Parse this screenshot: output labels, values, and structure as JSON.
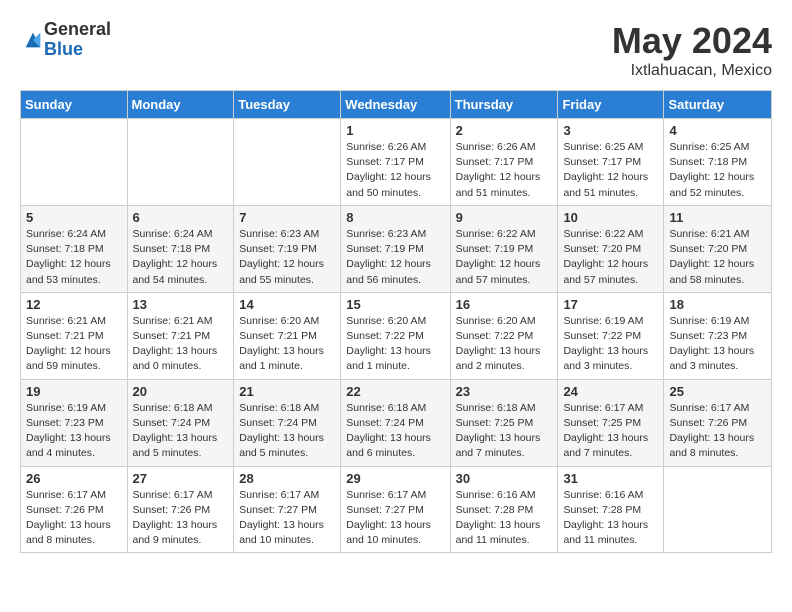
{
  "header": {
    "logo_general": "General",
    "logo_blue": "Blue",
    "title": "May 2024",
    "location": "Ixtlahuacan, Mexico"
  },
  "days_of_week": [
    "Sunday",
    "Monday",
    "Tuesday",
    "Wednesday",
    "Thursday",
    "Friday",
    "Saturday"
  ],
  "weeks": [
    [
      {
        "day": "",
        "info": ""
      },
      {
        "day": "",
        "info": ""
      },
      {
        "day": "",
        "info": ""
      },
      {
        "day": "1",
        "info": "Sunrise: 6:26 AM\nSunset: 7:17 PM\nDaylight: 12 hours\nand 50 minutes."
      },
      {
        "day": "2",
        "info": "Sunrise: 6:26 AM\nSunset: 7:17 PM\nDaylight: 12 hours\nand 51 minutes."
      },
      {
        "day": "3",
        "info": "Sunrise: 6:25 AM\nSunset: 7:17 PM\nDaylight: 12 hours\nand 51 minutes."
      },
      {
        "day": "4",
        "info": "Sunrise: 6:25 AM\nSunset: 7:18 PM\nDaylight: 12 hours\nand 52 minutes."
      }
    ],
    [
      {
        "day": "5",
        "info": "Sunrise: 6:24 AM\nSunset: 7:18 PM\nDaylight: 12 hours\nand 53 minutes."
      },
      {
        "day": "6",
        "info": "Sunrise: 6:24 AM\nSunset: 7:18 PM\nDaylight: 12 hours\nand 54 minutes."
      },
      {
        "day": "7",
        "info": "Sunrise: 6:23 AM\nSunset: 7:19 PM\nDaylight: 12 hours\nand 55 minutes."
      },
      {
        "day": "8",
        "info": "Sunrise: 6:23 AM\nSunset: 7:19 PM\nDaylight: 12 hours\nand 56 minutes."
      },
      {
        "day": "9",
        "info": "Sunrise: 6:22 AM\nSunset: 7:19 PM\nDaylight: 12 hours\nand 57 minutes."
      },
      {
        "day": "10",
        "info": "Sunrise: 6:22 AM\nSunset: 7:20 PM\nDaylight: 12 hours\nand 57 minutes."
      },
      {
        "day": "11",
        "info": "Sunrise: 6:21 AM\nSunset: 7:20 PM\nDaylight: 12 hours\nand 58 minutes."
      }
    ],
    [
      {
        "day": "12",
        "info": "Sunrise: 6:21 AM\nSunset: 7:21 PM\nDaylight: 12 hours\nand 59 minutes."
      },
      {
        "day": "13",
        "info": "Sunrise: 6:21 AM\nSunset: 7:21 PM\nDaylight: 13 hours\nand 0 minutes."
      },
      {
        "day": "14",
        "info": "Sunrise: 6:20 AM\nSunset: 7:21 PM\nDaylight: 13 hours\nand 1 minute."
      },
      {
        "day": "15",
        "info": "Sunrise: 6:20 AM\nSunset: 7:22 PM\nDaylight: 13 hours\nand 1 minute."
      },
      {
        "day": "16",
        "info": "Sunrise: 6:20 AM\nSunset: 7:22 PM\nDaylight: 13 hours\nand 2 minutes."
      },
      {
        "day": "17",
        "info": "Sunrise: 6:19 AM\nSunset: 7:22 PM\nDaylight: 13 hours\nand 3 minutes."
      },
      {
        "day": "18",
        "info": "Sunrise: 6:19 AM\nSunset: 7:23 PM\nDaylight: 13 hours\nand 3 minutes."
      }
    ],
    [
      {
        "day": "19",
        "info": "Sunrise: 6:19 AM\nSunset: 7:23 PM\nDaylight: 13 hours\nand 4 minutes."
      },
      {
        "day": "20",
        "info": "Sunrise: 6:18 AM\nSunset: 7:24 PM\nDaylight: 13 hours\nand 5 minutes."
      },
      {
        "day": "21",
        "info": "Sunrise: 6:18 AM\nSunset: 7:24 PM\nDaylight: 13 hours\nand 5 minutes."
      },
      {
        "day": "22",
        "info": "Sunrise: 6:18 AM\nSunset: 7:24 PM\nDaylight: 13 hours\nand 6 minutes."
      },
      {
        "day": "23",
        "info": "Sunrise: 6:18 AM\nSunset: 7:25 PM\nDaylight: 13 hours\nand 7 minutes."
      },
      {
        "day": "24",
        "info": "Sunrise: 6:17 AM\nSunset: 7:25 PM\nDaylight: 13 hours\nand 7 minutes."
      },
      {
        "day": "25",
        "info": "Sunrise: 6:17 AM\nSunset: 7:26 PM\nDaylight: 13 hours\nand 8 minutes."
      }
    ],
    [
      {
        "day": "26",
        "info": "Sunrise: 6:17 AM\nSunset: 7:26 PM\nDaylight: 13 hours\nand 8 minutes."
      },
      {
        "day": "27",
        "info": "Sunrise: 6:17 AM\nSunset: 7:26 PM\nDaylight: 13 hours\nand 9 minutes."
      },
      {
        "day": "28",
        "info": "Sunrise: 6:17 AM\nSunset: 7:27 PM\nDaylight: 13 hours\nand 10 minutes."
      },
      {
        "day": "29",
        "info": "Sunrise: 6:17 AM\nSunset: 7:27 PM\nDaylight: 13 hours\nand 10 minutes."
      },
      {
        "day": "30",
        "info": "Sunrise: 6:16 AM\nSunset: 7:28 PM\nDaylight: 13 hours\nand 11 minutes."
      },
      {
        "day": "31",
        "info": "Sunrise: 6:16 AM\nSunset: 7:28 PM\nDaylight: 13 hours\nand 11 minutes."
      },
      {
        "day": "",
        "info": ""
      }
    ]
  ]
}
